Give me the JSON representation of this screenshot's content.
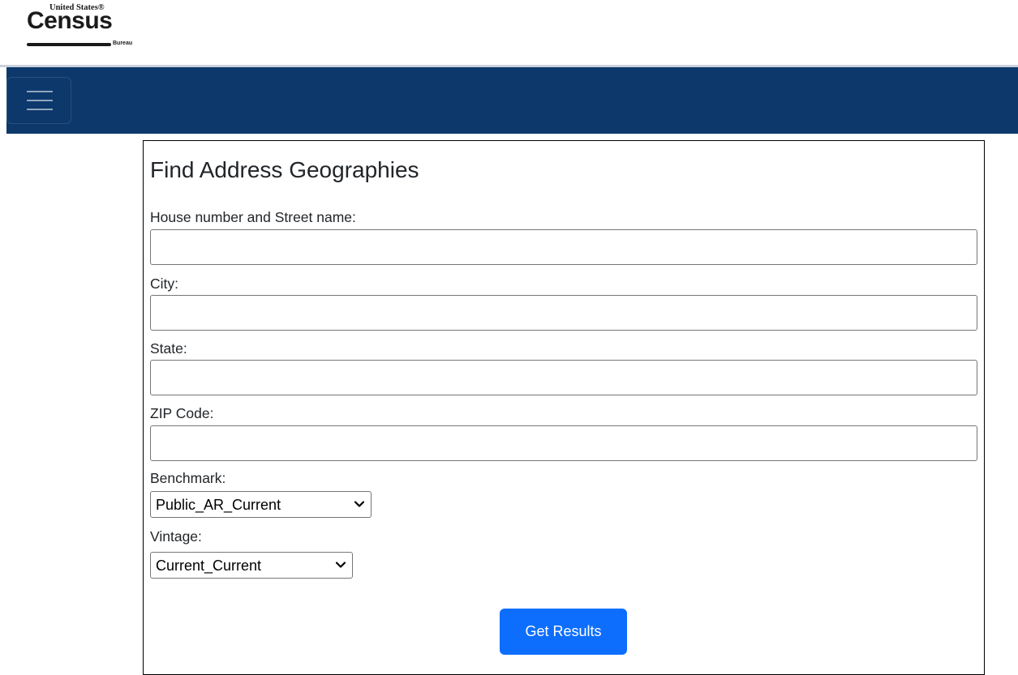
{
  "header": {
    "logo": {
      "top_text": "United States®",
      "main_text": "Census",
      "sub_text": "Bureau"
    }
  },
  "navbar": {
    "menu_icon": "hamburger-menu-icon"
  },
  "form": {
    "title": "Find Address Geographies",
    "street_label": "House number and Street name:",
    "street_value": "",
    "city_label": "City:",
    "city_value": "",
    "state_label": "State:",
    "state_value": "",
    "zip_label": "ZIP Code:",
    "zip_value": "",
    "benchmark_label": "Benchmark:",
    "benchmark_value": "Public_AR_Current",
    "vintage_label": "Vintage:",
    "vintage_value": "Current_Current",
    "submit_label": "Get Results"
  },
  "colors": {
    "navbar_bg": "#0c386c",
    "button_bg": "#0d6efd"
  }
}
